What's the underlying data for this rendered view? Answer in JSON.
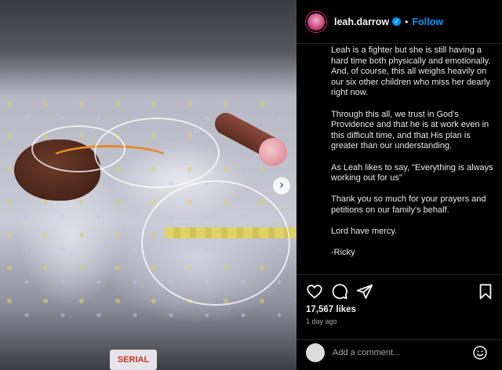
{
  "post": {
    "username": "leah.darrow",
    "separator": "•",
    "follow_label": "Follow",
    "verified_mark": "✓",
    "caption": [
      "Leah is a fighter but she is still having a hard time both physically and emotionally. And, of course, this all weighs heavily on our six other children who miss her dearly right now.",
      "Through this all, we trust in God's Providence and that he is at work even in this difficult time, and that His plan is greater than our understanding.",
      "As Leah likes to say, \"Everything is always working out for us\"",
      "Thank you so much for your prayers and petitions on our family's behalf.",
      "Lord have mercy.",
      "-Ricky"
    ],
    "likes": "17,567 likes",
    "time_ago": "1 day ago",
    "comment_placeholder": "Add a comment...",
    "photo_tag_text": "SERIAL",
    "carousel_next": "›"
  },
  "icons": {
    "like": "heart-icon",
    "comment": "comment-icon",
    "share": "share-icon",
    "save": "bookmark-icon",
    "emoji": "emoji-icon"
  },
  "colors": {
    "background": "#000000",
    "accent": "#0095f6",
    "text": "#f5f5f5",
    "muted": "#a8a8a8",
    "divider": "#262626"
  }
}
